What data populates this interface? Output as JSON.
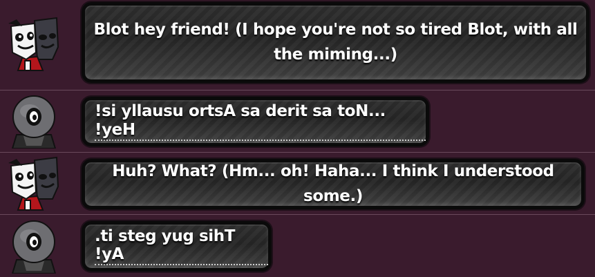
{
  "messages": [
    {
      "speaker_icon": "blot-avatar-icon",
      "text": "Blot hey friend! (I hope you're not so tired Blot, with all the miming...)",
      "underlined": false
    },
    {
      "speaker_icon": "mime-avatar-icon",
      "text": "!si yllausu ortsA sa derit sa toN... !yeH",
      "underlined": true
    },
    {
      "speaker_icon": "blot-avatar-icon",
      "text": "Huh? What? (Hm... oh! Haha... I think I understood some.)",
      "underlined": false
    },
    {
      "speaker_icon": "mime-avatar-icon",
      "text": ".ti steg yug sihT !yA",
      "underlined": true
    }
  ],
  "colors": {
    "background": "#3a1b2d",
    "separator": "#6a4a5c",
    "bubble": "#262626",
    "bubble_border": "#0a0a0a",
    "text": "#ffffff"
  }
}
